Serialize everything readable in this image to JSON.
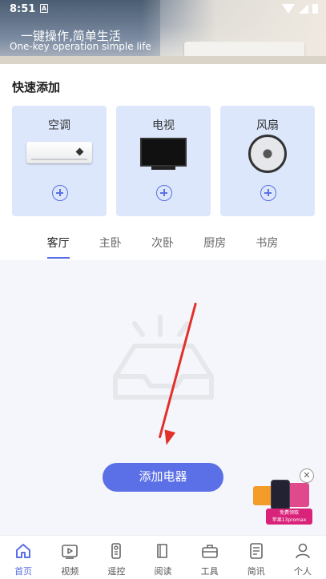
{
  "status_bar": {
    "time": "8:51",
    "notification_glyph": "A"
  },
  "banner": {
    "slogan_cn": "一键操作,简单生活",
    "slogan_en": "One-key operation simple life"
  },
  "quick_add": {
    "title": "快速添加",
    "cards": [
      {
        "label": "空调",
        "icon": "air-conditioner-image"
      },
      {
        "label": "电视",
        "icon": "television-image"
      },
      {
        "label": "风扇",
        "icon": "fan-image"
      }
    ]
  },
  "room_tabs": {
    "active_index": 0,
    "items": [
      "客厅",
      "主卧",
      "次卧",
      "厨房",
      "书房"
    ]
  },
  "add_appliance_button": "添加电器",
  "ad": {
    "ribbon_line1": "免费领取",
    "ribbon_line2": "苹果13promax"
  },
  "bottom_nav": {
    "active_index": 0,
    "items": [
      {
        "label": "首页",
        "icon": "home-icon"
      },
      {
        "label": "视频",
        "icon": "video-icon"
      },
      {
        "label": "遥控",
        "icon": "remote-icon"
      },
      {
        "label": "阅读",
        "icon": "book-icon"
      },
      {
        "label": "工具",
        "icon": "toolbox-icon"
      },
      {
        "label": "简讯",
        "icon": "news-icon"
      },
      {
        "label": "个人",
        "icon": "person-icon"
      }
    ]
  },
  "colors": {
    "accent": "#5b6fe6",
    "card_bg": "#dde7fc",
    "arrow": "#e2302a"
  }
}
